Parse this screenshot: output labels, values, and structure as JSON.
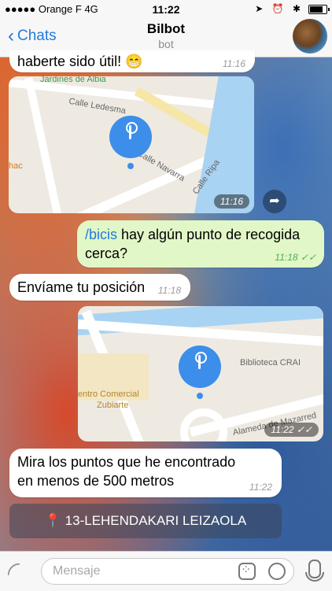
{
  "status": {
    "carrier": "Orange F",
    "network": "4G",
    "time": "11:22",
    "icons": "➤ ⏰ ✱"
  },
  "nav": {
    "back_label": "Chats",
    "title": "Bilbot",
    "subtitle": "bot"
  },
  "messages": [
    {
      "text": "haberte sido útil! 😁",
      "time": "11:16"
    },
    {
      "map_time": "11:16",
      "labels": [
        "Jardines de Albia",
        "Calle Ledesma",
        "Calle Navarra",
        "Calle Ripa",
        "hac"
      ]
    },
    {
      "command": "/bicis",
      "text": " hay algún punto de recogida cerca?",
      "time": "11:18",
      "ticks": "✓✓"
    },
    {
      "text": "Envíame tu posición",
      "time": "11:18"
    },
    {
      "map_time": "11:22",
      "ticks": "✓✓",
      "labels": [
        "Biblioteca CRAI",
        "entro Comercial",
        "Zubiarte",
        "Alameda de Mazarred"
      ]
    },
    {
      "text": "Mira los puntos que he encontrado en menos de 500 metros",
      "time": "11:22"
    }
  ],
  "location_button": "📍 13-LEHENDAKARI LEIZAOLA",
  "input": {
    "placeholder": "Mensaje"
  }
}
